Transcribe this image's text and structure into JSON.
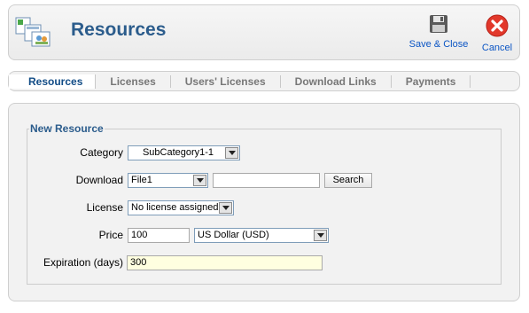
{
  "header": {
    "title": "Resources",
    "icons": {
      "app": "resources-icon",
      "save": "floppy-disk-icon",
      "cancel": "cancel-x-icon"
    },
    "toolbar": {
      "save_close_label": "Save & Close",
      "cancel_label": "Cancel"
    }
  },
  "tabs": [
    {
      "label": "Resources",
      "active": true
    },
    {
      "label": "Licenses",
      "active": false
    },
    {
      "label": "Users' Licenses",
      "active": false
    },
    {
      "label": "Download Links",
      "active": false
    },
    {
      "label": "Payments",
      "active": false
    }
  ],
  "form": {
    "legend": "New Resource",
    "category": {
      "label": "Category",
      "value": "SubCategory1-1"
    },
    "download": {
      "label": "Download",
      "value": "File1",
      "path_value": "",
      "search_label": "Search"
    },
    "license": {
      "label": "License",
      "value": "No license assigned"
    },
    "price": {
      "label": "Price",
      "amount": "100",
      "currency": "US Dollar (USD)"
    },
    "expiration": {
      "label": "Expiration (days)",
      "value": "300"
    }
  },
  "colors": {
    "title": "#2b5c8c",
    "toolbar_link": "#0b55c4",
    "cancel_red": "#e2382b",
    "active_field_bg": "#ffffe0"
  }
}
